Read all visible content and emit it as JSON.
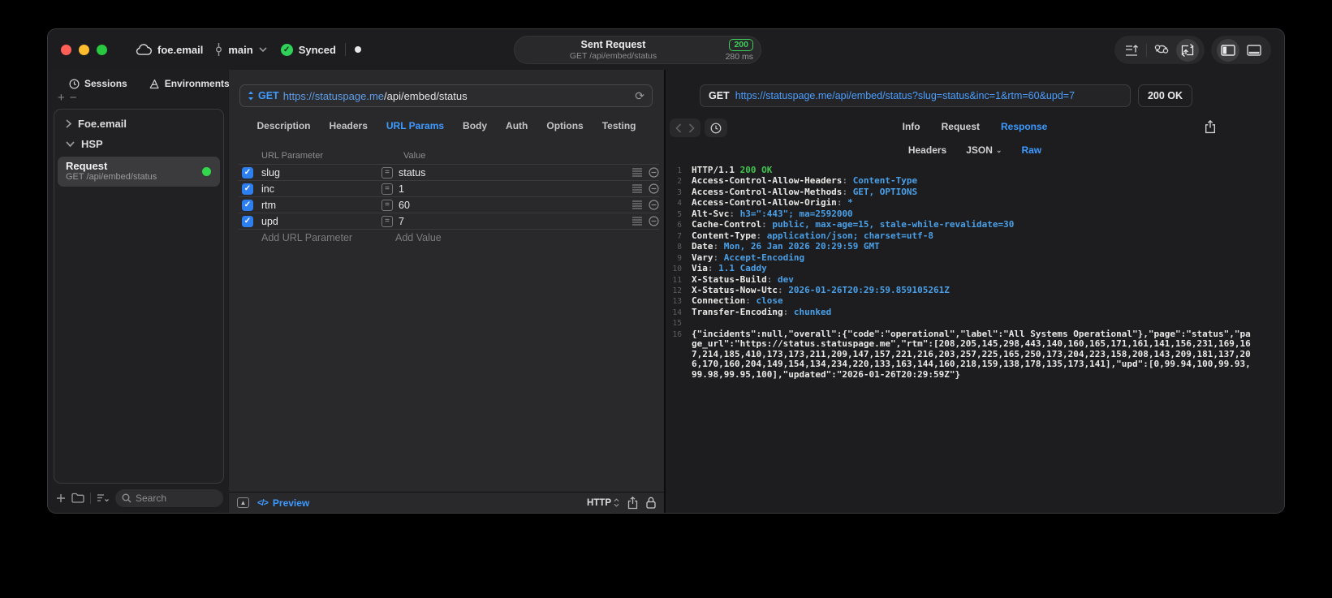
{
  "titlebar": {
    "workspace": "foe.email",
    "branch": "main",
    "sync_status": "Synced",
    "title": "Sent Request",
    "subtitle": "GET /api/embed/status",
    "status_code": "200",
    "duration": "280 ms"
  },
  "sidebar": {
    "tabs": [
      {
        "label": "Sessions",
        "icon": "clock-icon",
        "active": true
      },
      {
        "label": "Environments",
        "icon": "environments-icon",
        "active": false
      }
    ],
    "tree": [
      {
        "label": "Foe.email",
        "expanded": false
      },
      {
        "label": "HSP",
        "expanded": true
      }
    ],
    "request_item": {
      "title": "Request",
      "subtitle": "GET /api/embed/status",
      "selected": true,
      "status_color": "#32d74b"
    },
    "search_placeholder": "Search"
  },
  "request_editor": {
    "method": "GET",
    "url_scheme_host": "https://statuspage.me",
    "url_path": "/api/embed/status",
    "tabs": [
      {
        "label": "Description",
        "active": false
      },
      {
        "label": "Headers",
        "active": false
      },
      {
        "label": "URL Params",
        "active": true
      },
      {
        "label": "Body",
        "active": false
      },
      {
        "label": "Auth",
        "active": false
      },
      {
        "label": "Options",
        "active": false
      },
      {
        "label": "Testing",
        "active": false
      }
    ],
    "params": {
      "columns": [
        "URL Parameter",
        "Value"
      ],
      "rows": [
        {
          "name": "slug",
          "value": "status",
          "enabled": true
        },
        {
          "name": "inc",
          "value": "1",
          "enabled": true
        },
        {
          "name": "rtm",
          "value": "60",
          "enabled": true
        },
        {
          "name": "upd",
          "value": "7",
          "enabled": true
        }
      ],
      "add_name_placeholder": "Add URL Parameter",
      "add_value_placeholder": "Add Value"
    },
    "footer": {
      "preview_label": "Preview",
      "protocol": "HTTP"
    }
  },
  "response_panel": {
    "method": "GET",
    "url": "https://statuspage.me/api/embed/status?slug=status&inc=1&rtm=60&upd=7",
    "status": "200 OK",
    "tabs": [
      {
        "label": "Info",
        "active": false
      },
      {
        "label": "Request",
        "active": false
      },
      {
        "label": "Response",
        "active": true
      }
    ],
    "subtabs": [
      {
        "label": "Headers",
        "active": false,
        "dropdown": false
      },
      {
        "label": "JSON",
        "active": false,
        "dropdown": true
      },
      {
        "label": "Raw",
        "active": true,
        "dropdown": false
      }
    ],
    "status_line": {
      "num": 1,
      "protocol": "HTTP/1.1",
      "status": "200 OK"
    },
    "headers": [
      {
        "num": 2,
        "key": "Access-Control-Allow-Headers",
        "value": "Content-Type"
      },
      {
        "num": 3,
        "key": "Access-Control-Allow-Methods",
        "value": "GET, OPTIONS"
      },
      {
        "num": 4,
        "key": "Access-Control-Allow-Origin",
        "value": "*"
      },
      {
        "num": 5,
        "key": "Alt-Svc",
        "value": "h3=\":443\"; ma=2592000"
      },
      {
        "num": 6,
        "key": "Cache-Control",
        "value": "public, max-age=15, stale-while-revalidate=30"
      },
      {
        "num": 7,
        "key": "Content-Type",
        "value": "application/json; charset=utf-8"
      },
      {
        "num": 8,
        "key": "Date",
        "value": "Mon, 26 Jan 2026 20:29:59 GMT"
      },
      {
        "num": 9,
        "key": "Vary",
        "value": "Accept-Encoding"
      },
      {
        "num": 10,
        "key": "Via",
        "value": "1.1 Caddy"
      },
      {
        "num": 11,
        "key": "X-Status-Build",
        "value": "dev"
      },
      {
        "num": 12,
        "key": "X-Status-Now-Utc",
        "value": "2026-01-26T20:29:59.859105261Z"
      },
      {
        "num": 13,
        "key": "Connection",
        "value": "close"
      },
      {
        "num": 14,
        "key": "Transfer-Encoding",
        "value": "chunked"
      }
    ],
    "blank_line_num": 15,
    "body_line_num": 16,
    "body": "{\"incidents\":null,\"overall\":{\"code\":\"operational\",\"label\":\"All Systems Operational\"},\"page\":\"status\",\"page_url\":\"https://status.statuspage.me\",\"rtm\":[208,205,145,298,443,140,160,165,171,161,141,156,231,169,167,214,185,410,173,173,211,209,147,157,221,216,203,257,225,165,250,173,204,223,158,208,143,209,181,137,206,170,160,204,149,154,134,234,220,133,163,144,160,218,159,138,178,135,173,141],\"upd\":[0,99.94,100,99.93,99.98,99.95,100],\"updated\":\"2026-01-26T20:29:59Z\"}"
  },
  "colors": {
    "accent_blue": "#3d9aff",
    "success_green": "#30d158",
    "status_green_text": "#3ecf5a",
    "checkbox_blue": "#2d7ff0",
    "header_value_blue": "#4aa0e8",
    "panel_bg": "#1d1d1f",
    "editor_bg": "#29292b"
  }
}
